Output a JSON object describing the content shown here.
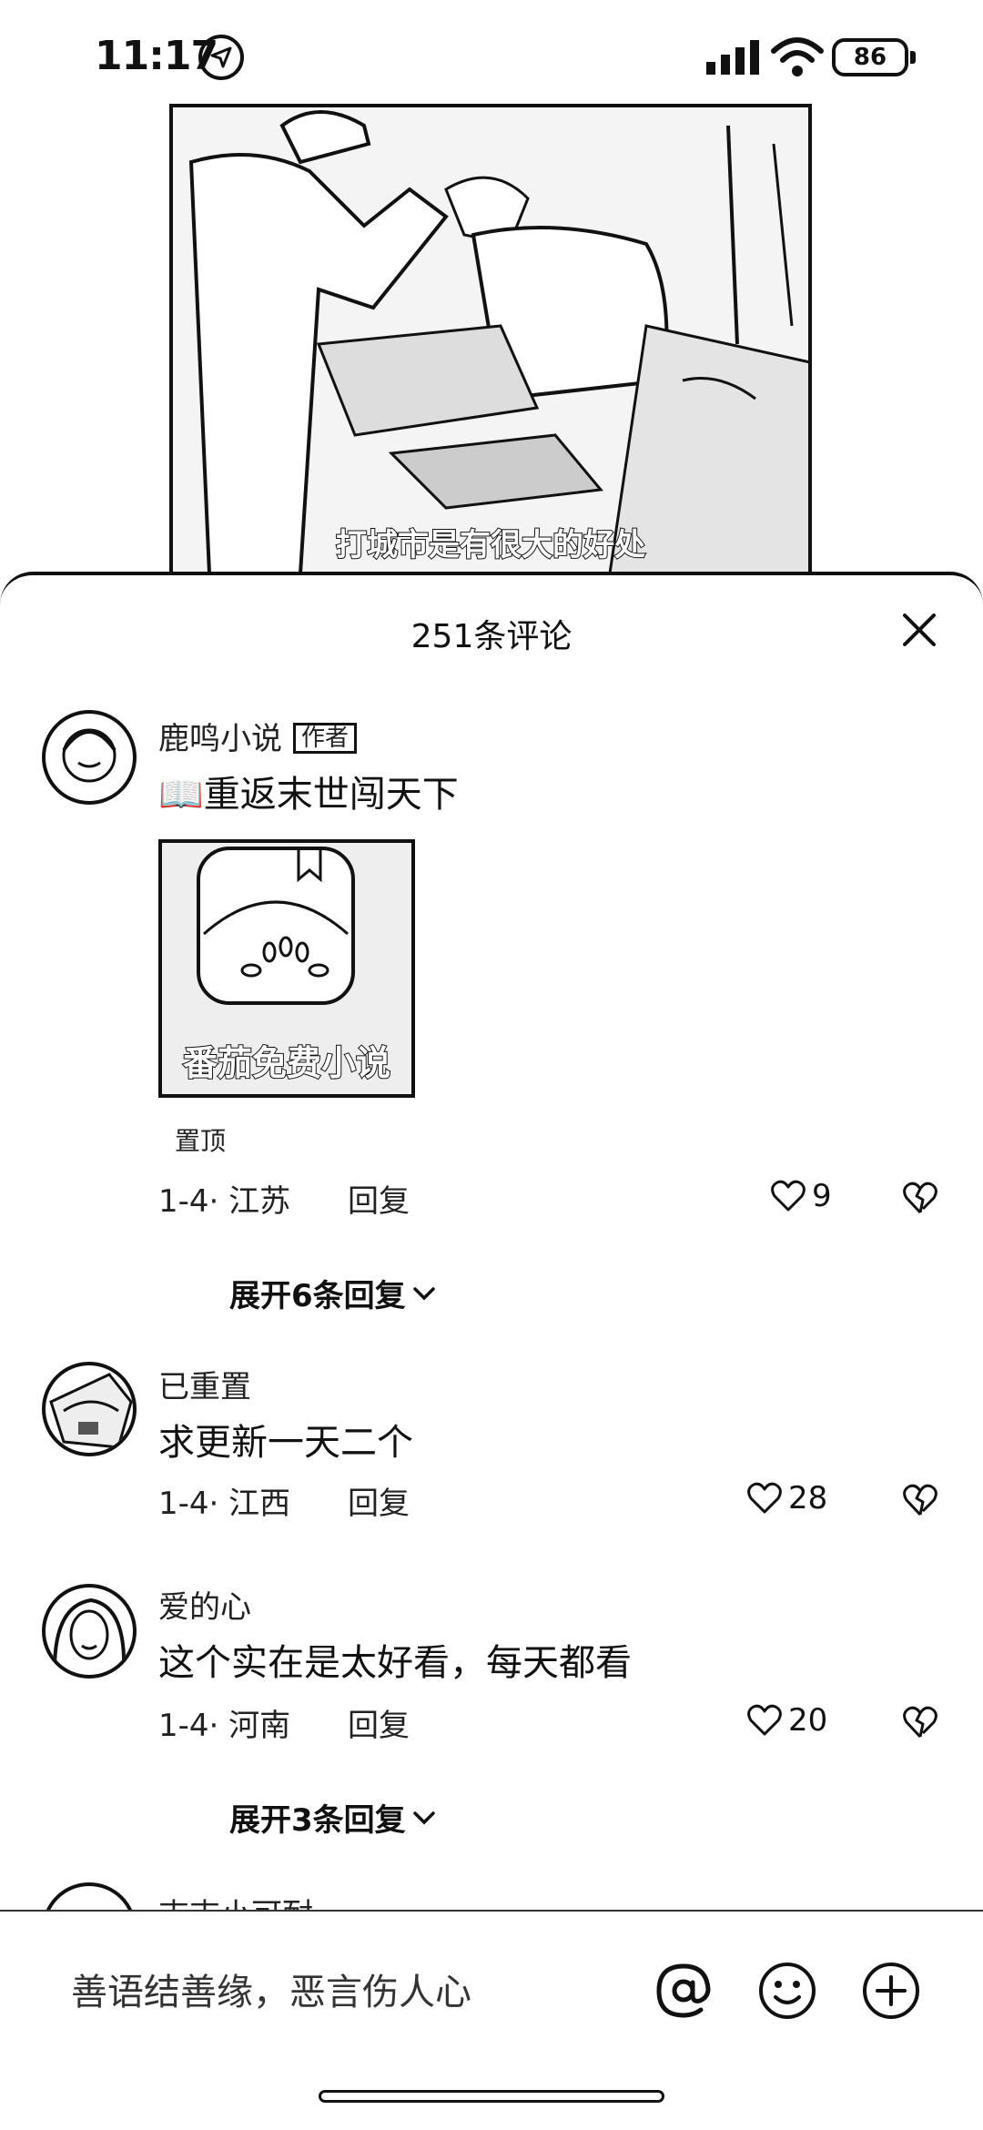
{
  "status_bar": {
    "time": "11:17",
    "battery": "86"
  },
  "video": {
    "subtitle": "打城市是有很大的好处"
  },
  "sheet": {
    "title": "251条评论"
  },
  "comments": [
    {
      "name": "鹿鸣小说",
      "author_tag": "作者",
      "text": "📖重返末世闯天下",
      "image_caption": "番茄免费小说",
      "pinned": "置顶",
      "meta": "1-4· 江苏",
      "reply": "回复",
      "likes": "9",
      "expand": "展开6条回复"
    },
    {
      "name": "已重置",
      "text": "求更新一天二个",
      "meta": "1-4· 江西",
      "reply": "回复",
      "likes": "28"
    },
    {
      "name": "爱的心",
      "text": "这个实在是太好看，每天都看",
      "meta": "1-4· 河南",
      "reply": "回复",
      "likes": "20",
      "expand": "展开3条回复"
    },
    {
      "name": "吉吉小可耐"
    }
  ],
  "input": {
    "placeholder": "善语结善缘，恶言伤人心"
  }
}
